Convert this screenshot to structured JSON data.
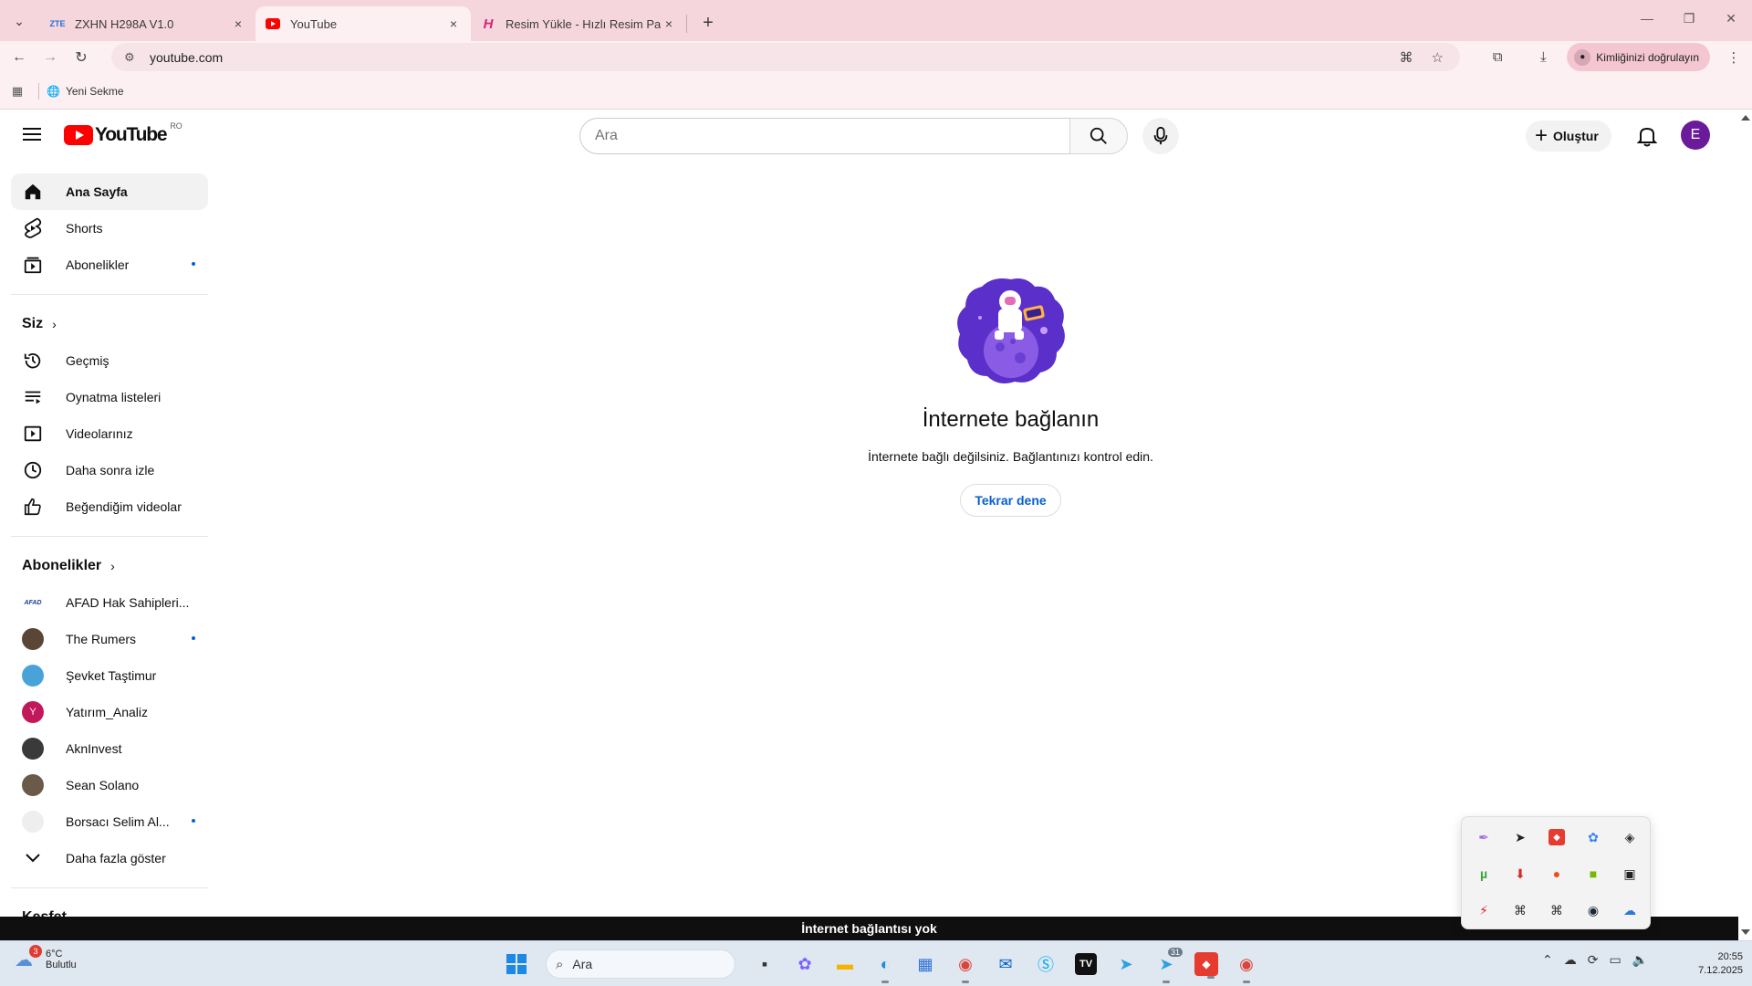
{
  "browser": {
    "tabs": [
      {
        "favicon": "ZTE",
        "title": "ZXHN H298A V1.0",
        "close": "×"
      },
      {
        "favicon": "youtube-icon",
        "title": "YouTube",
        "close": "×"
      },
      {
        "favicon": "H",
        "title": "Resim Yükle - Hızlı Resim Paylaş",
        "close": "×"
      }
    ],
    "new_tab": "+",
    "url": "youtube.com",
    "profile_label": "Kimliğinizi doğrulayın",
    "bookmarks": [
      {
        "label": "Yeni Sekme"
      }
    ]
  },
  "youtube": {
    "logo_text": "YouTube",
    "country": "RO",
    "search_placeholder": "Ara",
    "create_label": "Oluştur",
    "avatar_initial": "E",
    "sidebar": {
      "main": [
        {
          "label": "Ana Sayfa",
          "icon": "home-icon",
          "active": true
        },
        {
          "label": "Shorts",
          "icon": "shorts-icon"
        },
        {
          "label": "Abonelikler",
          "icon": "subscriptions-icon",
          "dot": true
        }
      ],
      "you_heading": "Siz",
      "you": [
        {
          "label": "Geçmiş",
          "icon": "history-icon"
        },
        {
          "label": "Oynatma listeleri",
          "icon": "playlists-icon"
        },
        {
          "label": "Videolarınız",
          "icon": "your-videos-icon"
        },
        {
          "label": "Daha sonra izle",
          "icon": "watch-later-icon"
        },
        {
          "label": "Beğendiğim videolar",
          "icon": "liked-icon"
        }
      ],
      "subs_heading": "Abonelikler",
      "subscriptions": [
        {
          "label": "AFAD Hak Sahipleri...",
          "avatar": "AFAD",
          "color": "#ffffff",
          "text": "#1a3c8f"
        },
        {
          "label": "The Rumers",
          "avatar": "",
          "color": "#5a4636",
          "dot": true
        },
        {
          "label": "Şevket Taştimur",
          "avatar": "",
          "color": "#4aa3d8"
        },
        {
          "label": "Yatırım_Analiz",
          "avatar": "Y",
          "color": "#c2185b"
        },
        {
          "label": "AknInvest",
          "avatar": "",
          "color": "#3a3a3a"
        },
        {
          "label": "Sean Solano",
          "avatar": "",
          "color": "#6b5a4a"
        },
        {
          "label": "Borsacı Selim Al...",
          "avatar": "",
          "color": "#eeeeee",
          "dot": true
        }
      ],
      "more_label": "Daha fazla göster",
      "explore_heading": "Keşfet"
    },
    "empty_state": {
      "title": "İnternete bağlanın",
      "subtitle": "İnternete bağlı değilsiniz. Bağlantınızı kontrol edin.",
      "retry": "Tekrar dene"
    },
    "offline_banner": "İnternet bağlantısı yok"
  },
  "taskbar": {
    "weather_temp": "6°C",
    "weather_desc": "Bulutlu",
    "weather_badge": "3",
    "search_label": "Ara",
    "telegram_badge": "31",
    "time": "20:55",
    "date": "7.12.2025"
  },
  "colors": {
    "accent": "#065fd4",
    "youtube_red": "#ff0000",
    "offline_bar": "#0f0f0f"
  }
}
